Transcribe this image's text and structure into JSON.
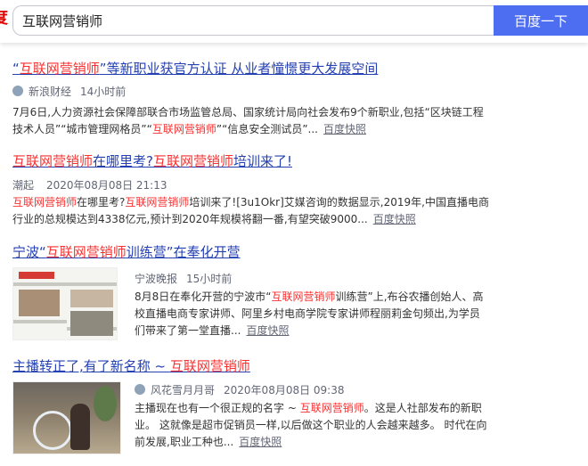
{
  "search": {
    "query": "互联网营销师",
    "button_label": "百度一下",
    "logo_fragment": "度"
  },
  "results": [
    {
      "title": [
        {
          "t": "“"
        },
        {
          "t": "互联网营销师",
          "em": true
        },
        {
          "t": "”等新职业获官方认证 从业者憧憬更大发展空间"
        }
      ],
      "source": "新浪财经",
      "time": "14小时前",
      "abstract": [
        {
          "t": "7月6日,人力资源社会保障部联合市场监管总局、国家统计局向社会发布9个新职业,包括“区块链工程技术人员”“城市管理网格员”“"
        },
        {
          "t": "互联网营销师",
          "em": true
        },
        {
          "t": "”“信息安全测试员”..."
        }
      ],
      "snapshot": "百度快照"
    },
    {
      "title": [
        {
          "t": "互联网营销师",
          "em": true
        },
        {
          "t": "在哪里考?"
        },
        {
          "t": "互联网营销师",
          "em": true
        },
        {
          "t": "培训来了!"
        }
      ],
      "source": "潮起",
      "time": "2020年08月08日 21:13",
      "abstract": [
        {
          "t": "互联网营销师",
          "em": true
        },
        {
          "t": "在哪里考?"
        },
        {
          "t": "互联网营销师",
          "em": true
        },
        {
          "t": "培训来了![3u1Okr]艾媒咨询的数据显示,2019年,中国直播电商行业的总规模达到4338亿元,预计到2020年规模将翻一番,有望突破9000..."
        }
      ],
      "snapshot": "百度快照"
    },
    {
      "title": [
        {
          "t": "宁波“"
        },
        {
          "t": "互联网营销师",
          "em": true
        },
        {
          "t": "训练营”在奉化开营"
        }
      ],
      "source": "宁波晚报",
      "time": "15小时前",
      "abstract": [
        {
          "t": "8月8日在奉化开营的宁波市“"
        },
        {
          "t": "互联网营销师",
          "em": true
        },
        {
          "t": "训练营”上,布谷农播创始人、高校直播电商专家讲师、阿里乡村电商学院专家讲师程丽莉金句频出,为学员们带来了第一堂直播..."
        }
      ],
      "snapshot": "百度快照",
      "thumbnail": "newspaper-thumbnail"
    },
    {
      "title": [
        {
          "t": "主播转正了,有了新名称 ~ "
        },
        {
          "t": "互联网营销师",
          "em": true
        }
      ],
      "source": "风花雪月月哥",
      "time": "2020年08月08日 09:38",
      "abstract": [
        {
          "t": "主播现在也有一个很正规的名字 ~ "
        },
        {
          "t": "互联网营销师",
          "em": true
        },
        {
          "t": "。这是人社部发布的新职业。 这就像是超市促销员一样,以后做这个职业的人会越来越多。 时代在向前发展,职业工种也..."
        }
      ],
      "snapshot": "百度快照",
      "thumbnail": "livestream-photo-thumbnail"
    }
  ]
}
